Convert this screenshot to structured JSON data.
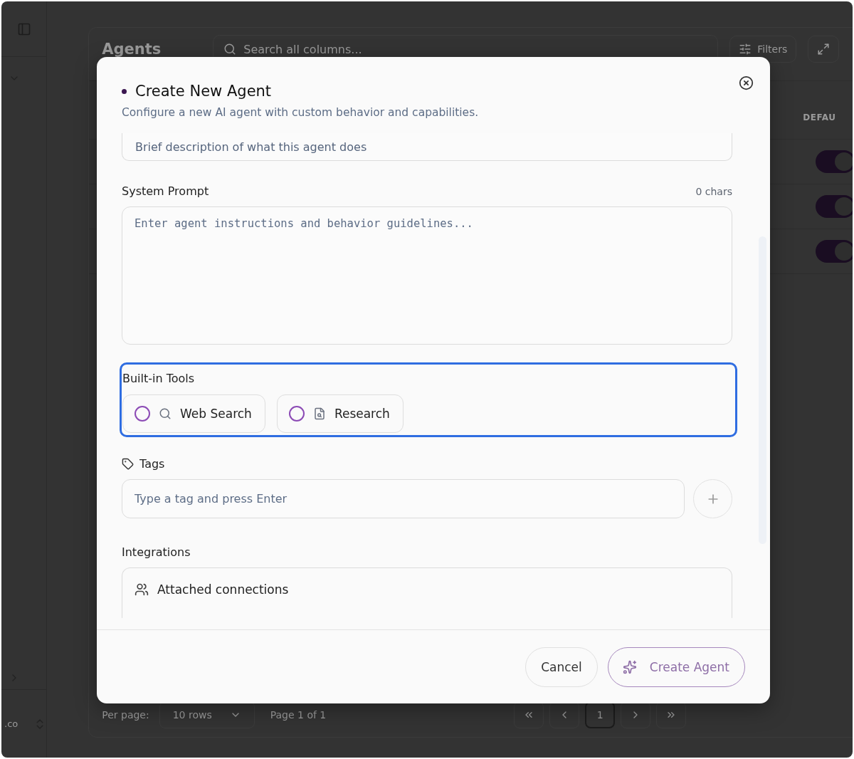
{
  "background": {
    "title": "Agents",
    "search": {
      "placeholder": "Search all columns..."
    },
    "filters_button": "Filters",
    "column_header": "DEFAU",
    "rows": [
      {
        "default_on": true
      },
      {
        "default_on": true
      },
      {
        "default_on": true
      }
    ],
    "pagination": {
      "per_page_label": "Per page:",
      "per_page_value": "10 rows",
      "page_info": "Page 1 of 1",
      "pages": [
        {
          "label": "1",
          "selected": true
        }
      ]
    },
    "sidebar": {
      "account_text": ".co"
    }
  },
  "dialog": {
    "title": "Create New Agent",
    "description": "Configure a new AI agent with custom behavior and capabilities.",
    "description_field": {
      "placeholder": "Brief description of what this agent does"
    },
    "system_prompt": {
      "label": "System Prompt",
      "counter": "0 chars",
      "placeholder": "Enter agent instructions and behavior guidelines..."
    },
    "built_in_tools": {
      "label": "Built-in Tools",
      "focused": true,
      "tools": [
        {
          "kind": "search",
          "label": "Web Search",
          "selected": false
        },
        {
          "kind": "research",
          "label": "Research",
          "selected": false
        }
      ]
    },
    "tags": {
      "label": "Tags",
      "placeholder": "Type a tag and press Enter"
    },
    "integrations": {
      "label": "Integrations",
      "attached": "Attached connections"
    },
    "buttons": {
      "cancel": "Cancel",
      "submit": "Create Agent"
    }
  }
}
